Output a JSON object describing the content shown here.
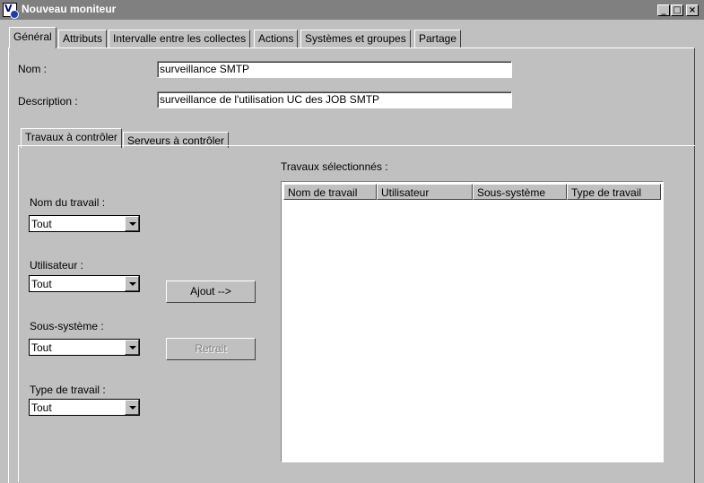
{
  "window": {
    "title": "Nouveau moniteur",
    "minimize": "_",
    "maximize": "□",
    "close": "×"
  },
  "tabs": [
    {
      "label": "Général"
    },
    {
      "label": "Attributs"
    },
    {
      "label": "Intervalle entre les collectes"
    },
    {
      "label": "Actions"
    },
    {
      "label": "Systèmes et groupes"
    },
    {
      "label": "Partage"
    }
  ],
  "form": {
    "name_label": "Nom :",
    "name_value": "surveillance SMTP",
    "description_label": "Description :",
    "description_value": "surveillance de l'utilisation UC des JOB SMTP"
  },
  "subtabs": [
    {
      "label": "Travaux à contrôler"
    },
    {
      "label": "Serveurs à contrôler"
    }
  ],
  "filters": {
    "job_name_label": "Nom du travail :",
    "job_name_value": "Tout",
    "user_label": "Utilisateur :",
    "user_value": "Tout",
    "subsystem_label": "Sous-système :",
    "subsystem_value": "Tout",
    "job_type_label": "Type de travail :",
    "job_type_value": "Tout"
  },
  "buttons": {
    "add": "Ajout -->",
    "remove": "Retrait"
  },
  "selected": {
    "label": "Travaux sélectionnés :",
    "columns": [
      "Nom de travail",
      "Utilisateur",
      "Sous-système",
      "Type de travail"
    ]
  }
}
